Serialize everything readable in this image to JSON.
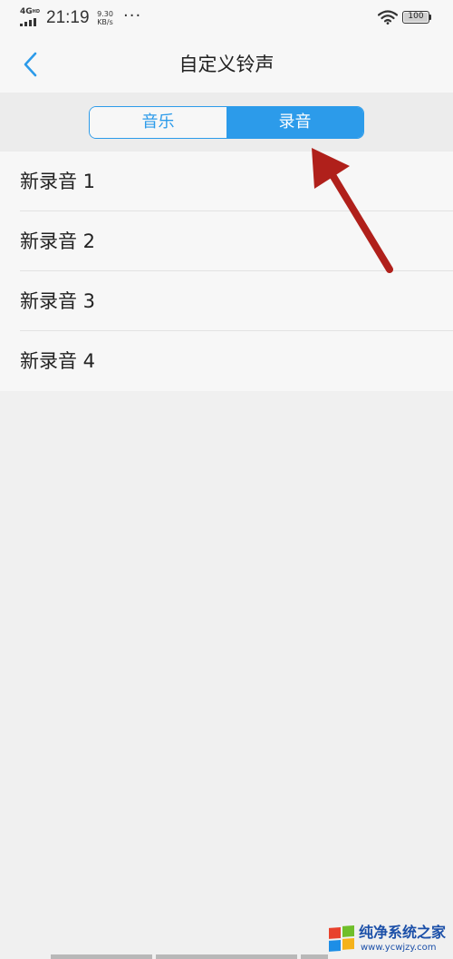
{
  "status_bar": {
    "network": "4G",
    "network_hd": "HD",
    "time": "21:19",
    "speed_value": "9.30",
    "speed_unit": "KB/s",
    "more": "···",
    "battery": "100"
  },
  "header": {
    "title": "自定义铃声",
    "back_icon": "chevron-left-icon"
  },
  "tabs": [
    {
      "label": "音乐",
      "selected": false
    },
    {
      "label": "录音",
      "selected": true
    }
  ],
  "recordings": [
    {
      "label": "新录音 1"
    },
    {
      "label": "新录音 2"
    },
    {
      "label": "新录音 3"
    },
    {
      "label": "新录音 4"
    }
  ],
  "watermark": {
    "name": "纯净系统之家",
    "url": "www.ycwjzy.com"
  },
  "colors": {
    "accent": "#2c9bea",
    "annotation": "#b0201b",
    "background": "#f0f0f0"
  }
}
